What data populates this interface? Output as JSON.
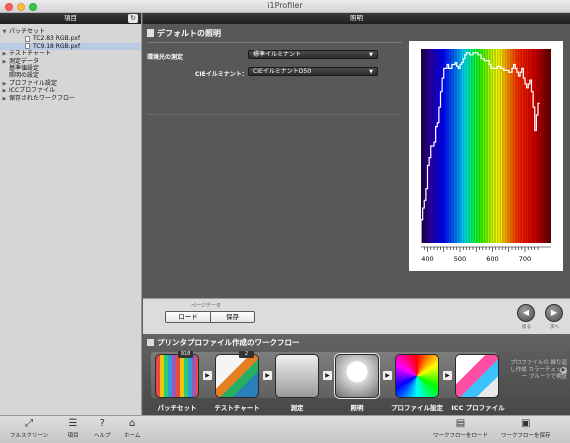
{
  "window": {
    "title": "i1Profiler"
  },
  "sidebar": {
    "header": "項目",
    "refresh_icon": "↻",
    "tree": [
      {
        "label": "パッチセット",
        "expanded": true,
        "children": [
          {
            "label": "TC2.83 RGB.pxf",
            "selected": false
          },
          {
            "label": "TC9.18 RGB.pxf",
            "selected": true
          }
        ]
      },
      {
        "label": "テストチャート"
      },
      {
        "label": "測定データ"
      },
      {
        "label": "基準値設定"
      },
      {
        "label": "照明の設定"
      },
      {
        "label": "プロファイル設定"
      },
      {
        "label": "ICCプロファイル"
      },
      {
        "label": "保存されたワークフロー"
      }
    ]
  },
  "main": {
    "header": "照明",
    "section_title": "デフォルトの照明",
    "measure_label": "環境光の測定",
    "measure_value": "標準イルミナント",
    "cie_label": "CIEイルミナント：",
    "cie_value": "CIEイルミナントD50"
  },
  "chart_data": {
    "type": "line",
    "title": "",
    "xlabel": "",
    "ylabel": "",
    "xlim": [
      380,
      780
    ],
    "ylim": [
      0,
      1
    ],
    "xticks": [
      400,
      500,
      600,
      700
    ],
    "x": [
      380,
      385,
      390,
      395,
      400,
      405,
      410,
      415,
      420,
      425,
      430,
      435,
      440,
      445,
      450,
      455,
      460,
      465,
      470,
      475,
      480,
      485,
      490,
      495,
      500,
      505,
      510,
      515,
      520,
      525,
      530,
      535,
      540,
      545,
      550,
      555,
      560,
      565,
      570,
      575,
      580,
      585,
      590,
      595,
      600,
      605,
      610,
      615,
      620,
      625,
      630,
      635,
      640,
      645,
      650,
      655,
      660,
      665,
      670,
      675,
      680,
      685,
      690,
      695,
      700,
      705,
      710,
      715,
      720,
      725,
      730,
      735,
      740
    ],
    "series": [
      {
        "name": "",
        "values": [
          0.12,
          0.18,
          0.22,
          0.28,
          0.4,
          0.44,
          0.5,
          0.5,
          0.52,
          0.6,
          0.62,
          0.7,
          0.78,
          0.85,
          0.9,
          0.9,
          0.92,
          0.9,
          0.9,
          0.92,
          0.92,
          0.93,
          0.91,
          0.9,
          0.92,
          0.93,
          0.95,
          0.97,
          0.98,
          0.98,
          0.97,
          0.97,
          0.98,
          0.98,
          0.98,
          0.97,
          0.97,
          0.95,
          0.95,
          0.94,
          0.94,
          0.94,
          0.92,
          0.9,
          0.9,
          0.9,
          0.9,
          0.91,
          0.91,
          0.9,
          0.9,
          0.89,
          0.89,
          0.89,
          0.88,
          0.88,
          0.9,
          0.92,
          0.9,
          0.88,
          0.86,
          0.88,
          0.9,
          0.85,
          0.82,
          0.8,
          0.82,
          0.84,
          0.78,
          0.7,
          0.58,
          0.66,
          0.72
        ]
      }
    ]
  },
  "controls": {
    "page_data_label": "ページデータ",
    "load_label": "ロード",
    "save_label": "保存",
    "back_label": "戻る",
    "next_label": "次へ"
  },
  "workflow": {
    "title": "プリンタプロファイル作成のワークフロー",
    "steps": [
      {
        "label": "パッチセット",
        "badge": "918"
      },
      {
        "label": "テストチャート",
        "badge": "2"
      },
      {
        "label": "測定"
      },
      {
        "label": "照明"
      },
      {
        "label": "プロファイル設定"
      },
      {
        "label": "ICC プロファイル"
      }
    ],
    "note": "プロファイルの 繰り返し作成 カラーチェッカー プルーフで検証"
  },
  "toolbar": {
    "fullscreen": "フルスクリーン",
    "items": "項目",
    "help": "ヘルプ",
    "home": "ホーム",
    "load_workflow": "ワークフローをロード",
    "save_workflow": "ワークフローを保存"
  },
  "colors": {
    "accent_selected": "#b9cbe3",
    "panel_dark": "#585858",
    "chart_line": "#ffffff"
  }
}
